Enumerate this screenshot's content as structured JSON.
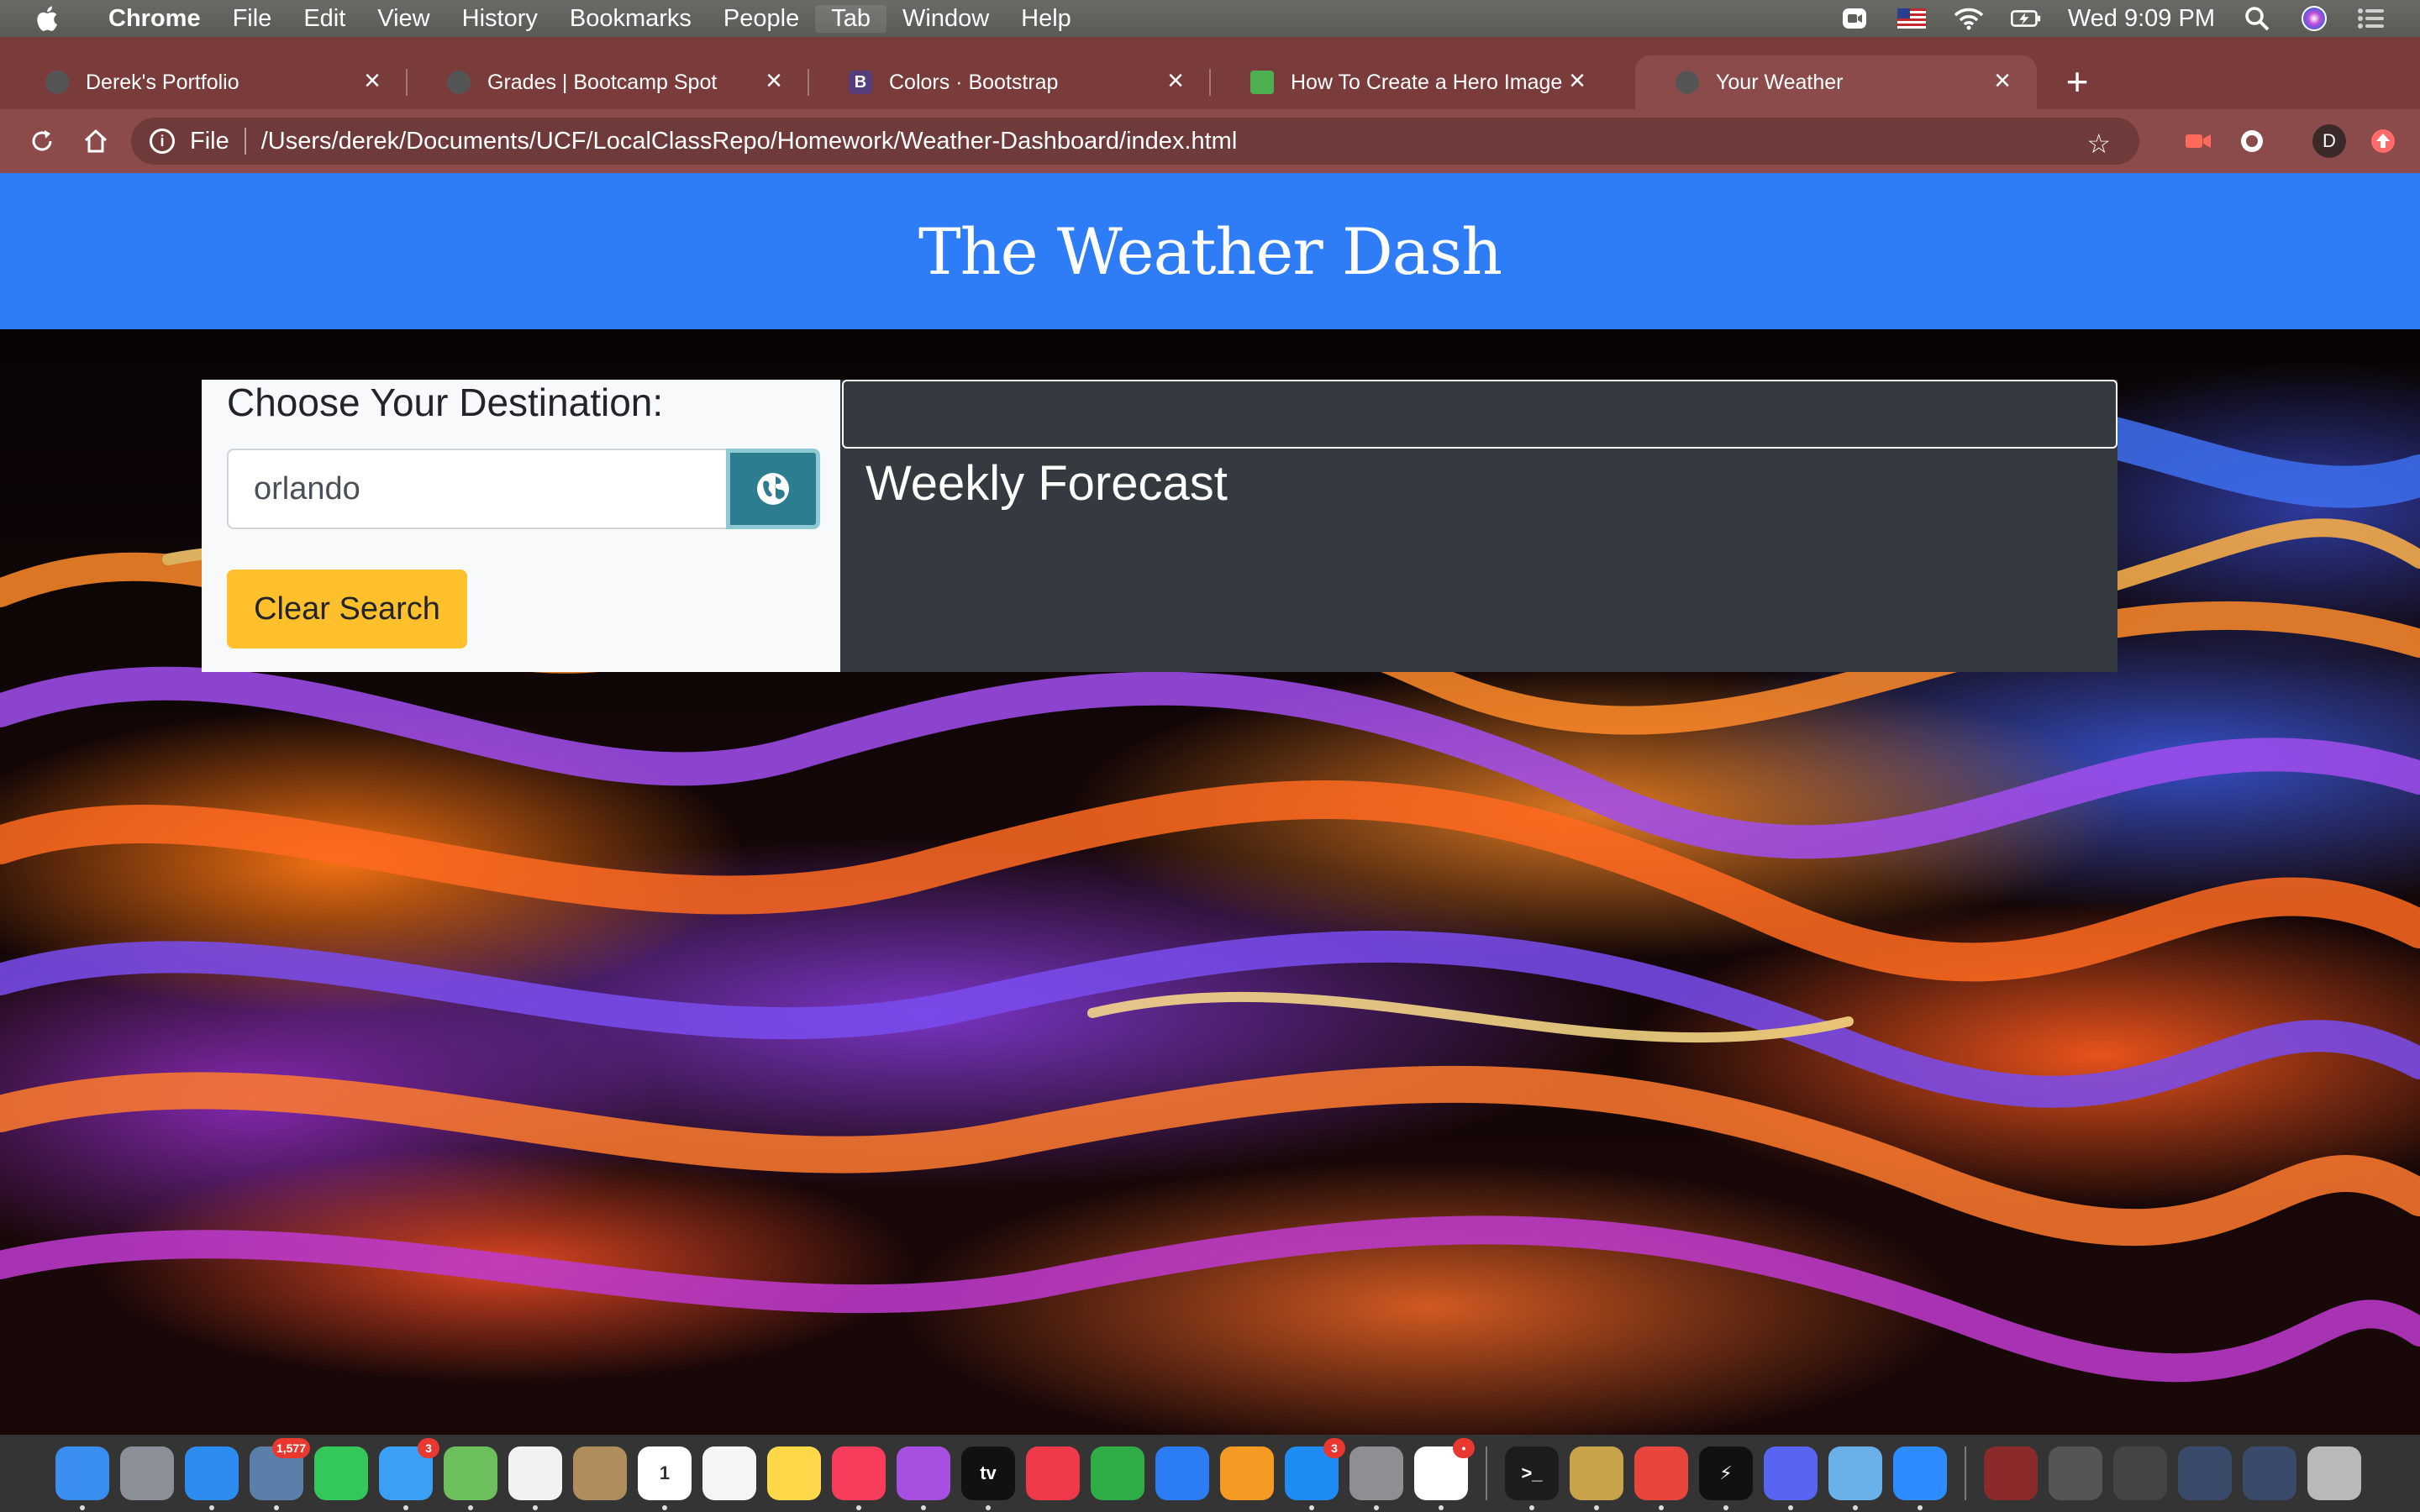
{
  "menubar": {
    "app": "Chrome",
    "items": [
      "File",
      "Edit",
      "View",
      "History",
      "Bookmarks",
      "People",
      "Tab",
      "Window",
      "Help"
    ],
    "active_item": "Tab",
    "clock": "Wed 9:09 PM"
  },
  "browser": {
    "tabs": [
      {
        "title": "Derek's Portfolio",
        "favicon": "globe-icon"
      },
      {
        "title": "Grades | Bootcamp Spot",
        "favicon": "globe-icon"
      },
      {
        "title": "Colors · Bootstrap",
        "favicon": "bootstrap-icon",
        "favicon_text": "B"
      },
      {
        "title": "How To Create a Hero Image",
        "favicon": "w3schools-icon"
      },
      {
        "title": "Your Weather",
        "favicon": "globe-icon",
        "active": true
      }
    ],
    "omnibox": {
      "scheme": "File",
      "url": "/Users/derek/Documents/UCF/LocalClassRepo/Homework/Weather-Dashboard/index.html"
    },
    "profile_initial": "D"
  },
  "page": {
    "title": "The Weather Dash",
    "search": {
      "heading": "Choose Your Destination:",
      "input_value": "orlando",
      "search_icon": "globe-icon",
      "clear_label": "Clear Search"
    },
    "forecast": {
      "heading": "Weekly Forecast"
    }
  },
  "colors": {
    "jumbotron": "#2f7df6",
    "search_button": "#2b7d8f",
    "clear_button": "#ffc02b",
    "forecast_panel": "#343a40",
    "tab_strip": "#7a3b3b"
  },
  "dock": {
    "apps": [
      {
        "name": "finder-icon",
        "color": "#3a8ef0"
      },
      {
        "name": "launchpad-icon",
        "color": "#8a8f98"
      },
      {
        "name": "safari-icon",
        "color": "#2d8cf0"
      },
      {
        "name": "mail-stamp-icon",
        "color": "#5b7fa8",
        "badge": "1,577"
      },
      {
        "name": "facetime-icon",
        "color": "#34c759"
      },
      {
        "name": "messages-icon",
        "color": "#3aa0f5",
        "badge": "3"
      },
      {
        "name": "maps-icon",
        "color": "#6cbf5a"
      },
      {
        "name": "photos-icon",
        "color": "#f2f2f2"
      },
      {
        "name": "contacts-icon",
        "color": "#b08d5c"
      },
      {
        "name": "calendar-icon",
        "color": "#ffffff",
        "text": "1"
      },
      {
        "name": "reminders-icon",
        "color": "#f5f5f5"
      },
      {
        "name": "notes-icon",
        "color": "#ffd84a"
      },
      {
        "name": "music-icon",
        "color": "#fa3c5c"
      },
      {
        "name": "podcasts-icon",
        "color": "#a74fe0"
      },
      {
        "name": "apple-tv-icon",
        "color": "#111111",
        "text": "tv"
      },
      {
        "name": "news-icon",
        "color": "#f03a4a"
      },
      {
        "name": "numbers-icon",
        "color": "#2fae48"
      },
      {
        "name": "keynote-icon",
        "color": "#2c7cf6"
      },
      {
        "name": "pages-icon",
        "color": "#f59a23"
      },
      {
        "name": "app-store-icon",
        "color": "#1f8cf5",
        "badge": "3"
      },
      {
        "name": "system-preferences-icon",
        "color": "#8e8e93"
      },
      {
        "name": "slack-icon",
        "color": "#ffffff",
        "badge": "•"
      },
      {
        "name": "separator"
      },
      {
        "name": "terminal-icon",
        "color": "#1c1c1e",
        "text": ">_"
      },
      {
        "name": "keychain-icon",
        "color": "#c9a34a"
      },
      {
        "name": "chrome-icon",
        "color": "#e8453c"
      },
      {
        "name": "hyper-terminal-icon",
        "color": "#111111",
        "text": "⚡"
      },
      {
        "name": "discord-icon",
        "color": "#5865f2"
      },
      {
        "name": "preview-icon",
        "color": "#6ab0e8"
      },
      {
        "name": "zoom-icon",
        "color": "#2d8cff"
      },
      {
        "name": "separator"
      },
      {
        "name": "downloads-stack-icon",
        "color": "#8a2a2a"
      },
      {
        "name": "documents-stack-icon",
        "color": "#555555"
      },
      {
        "name": "desktop-stack-icon",
        "color": "#444444"
      },
      {
        "name": "screenshots-stack-icon",
        "color": "#3a4a6a"
      },
      {
        "name": "recent-stack-icon",
        "color": "#3a4a6a"
      },
      {
        "name": "trash-icon",
        "color": "#b9b9b9"
      }
    ]
  }
}
